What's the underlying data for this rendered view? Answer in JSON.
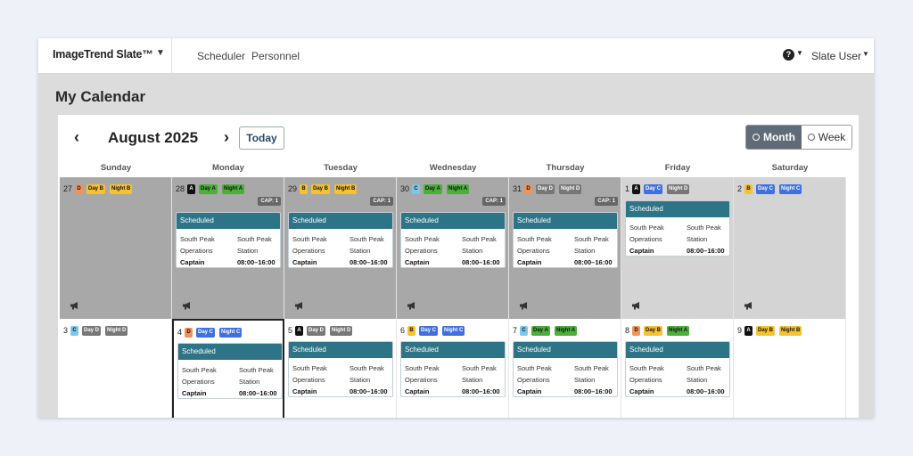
{
  "topbar": {
    "brand": "ImageTrend Slate™",
    "nav": [
      "Scheduler",
      "Personnel"
    ],
    "help": "?",
    "user": "Slate User"
  },
  "page": {
    "title": "My Calendar"
  },
  "calendar": {
    "month_title": "August 2025",
    "today_label": "Today",
    "view_month": "Month",
    "view_week": "Week",
    "weekdays": [
      "Sunday",
      "Monday",
      "Tuesday",
      "Wednesday",
      "Thursday",
      "Friday",
      "Saturday"
    ],
    "schedule": {
      "status": "Scheduled",
      "location_1": "South Peak",
      "location_2": "Operations",
      "station_1": "South Peak",
      "station_2": "Station",
      "role": "Captain",
      "time": "08:00–16:00"
    },
    "cap_label": "CAP: 1",
    "colors": {
      "D": "#f0935a",
      "A": "#111111",
      "B": "#f5c230",
      "C": "#7cc8ec",
      "day_a": "#4caf3a",
      "night_a": "#4caf3a",
      "day_b": "#f5c230",
      "night_b": "#f5c230",
      "day_c": "#3f6fe0",
      "night_c": "#3f6fe0",
      "day_d": "#777777",
      "night_d": "#777777",
      "header_teal": "#2c7486"
    },
    "days": [
      {
        "num": "27",
        "platoon": "D",
        "tags": [
          "Day B",
          "Night B"
        ]
      },
      {
        "num": "28",
        "platoon": "A",
        "tags": [
          "Day A",
          "Night A"
        ]
      },
      {
        "num": "29",
        "platoon": "B",
        "tags": [
          "Day B",
          "Night B"
        ]
      },
      {
        "num": "30",
        "platoon": "C",
        "tags": [
          "Day A",
          "Night A"
        ]
      },
      {
        "num": "31",
        "platoon": "D",
        "tags": [
          "Day D",
          "Night D"
        ]
      },
      {
        "num": "1",
        "platoon": "A",
        "tags": [
          "Day C",
          "Night D"
        ]
      },
      {
        "num": "2",
        "platoon": "B",
        "tags": [
          "Day C",
          "Night C"
        ]
      },
      {
        "num": "3",
        "platoon": "C",
        "tags": [
          "Day D",
          "Night D"
        ]
      },
      {
        "num": "4",
        "platoon": "D",
        "tags": [
          "Day C",
          "Night C"
        ]
      },
      {
        "num": "5",
        "platoon": "A",
        "tags": [
          "Day D",
          "Night D"
        ]
      },
      {
        "num": "6",
        "platoon": "B",
        "tags": [
          "Day C",
          "Night C"
        ]
      },
      {
        "num": "7",
        "platoon": "C",
        "tags": [
          "Day A",
          "Night A"
        ]
      },
      {
        "num": "8",
        "platoon": "D",
        "tags": [
          "Day B",
          "Night A"
        ]
      },
      {
        "num": "9",
        "platoon": "A",
        "tags": [
          "Day B",
          "Night B"
        ]
      }
    ]
  }
}
